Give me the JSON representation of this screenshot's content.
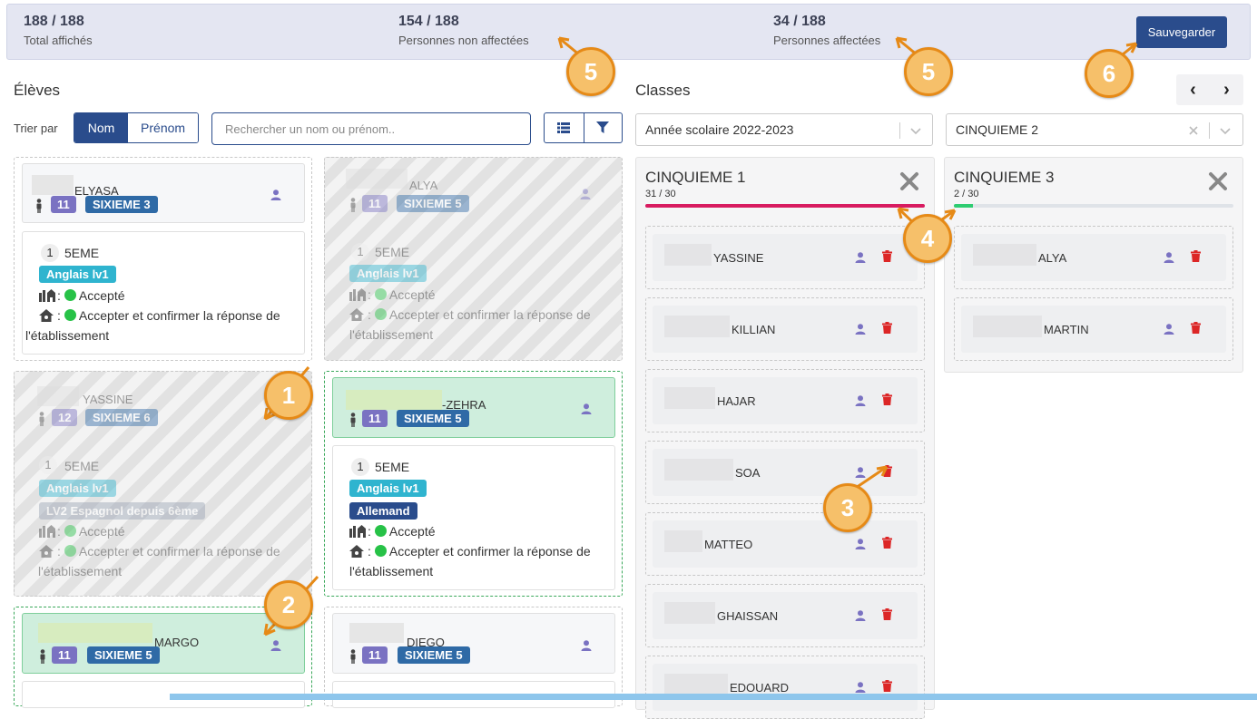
{
  "stats": {
    "total_value": "188 / 188",
    "total_label": "Total affichés",
    "unassigned_value": "154 / 188",
    "unassigned_label": "Personnes non affectées",
    "assigned_value": "34 / 188",
    "assigned_label": "Personnes affectées",
    "save_label": "Sauvegarder"
  },
  "students_panel": {
    "title": "Élèves",
    "sort_label": "Trier par",
    "sort_options": [
      "Nom",
      "Prénom"
    ],
    "search_placeholder": "Rechercher un nom ou prénom.."
  },
  "classes_panel": {
    "title": "Classes",
    "prev": "‹",
    "next": "›",
    "year_select": "Année scolaire 2022-2023",
    "class_select": "CINQUIEME 2"
  },
  "students": [
    {
      "name": "ELYASA",
      "age": "11",
      "class": "SIXIEME 3",
      "rank": "1",
      "level": "5EME",
      "tags": [
        "Anglais lv1"
      ],
      "status1": "Accepté",
      "status2": "Accepter et confirmer la réponse de",
      "status2b": "l'établissement"
    },
    {
      "name": "ALYA",
      "age": "11",
      "class": "SIXIEME 5",
      "rank": "1",
      "level": "5EME",
      "tags": [
        "Anglais lv1"
      ],
      "status1": "Accepté",
      "status2": "Accepter et confirmer la réponse de",
      "status2b": "l'établissement"
    },
    {
      "name": "YASSINE",
      "age": "12",
      "class": "SIXIEME 6",
      "rank": "1",
      "level": "5EME",
      "tags": [
        "Anglais lv1",
        "LV2 Espagnol depuis 6ème"
      ],
      "status1": "Accepté",
      "status2": "Accepter et confirmer la réponse de",
      "status2b": "l'établissement"
    },
    {
      "name": "-ZEHRA",
      "age": "11",
      "class": "SIXIEME 5",
      "rank": "1",
      "level": "5EME",
      "tags": [
        "Anglais lv1",
        "Allemand"
      ],
      "status1": "Accepté",
      "status2": "Accepter et confirmer la réponse de",
      "status2b": "l'établissement"
    },
    {
      "name": "MARGO",
      "age": "11",
      "class": "SIXIEME 5"
    },
    {
      "name": "DIEGO",
      "age": "11",
      "class": "SIXIEME 5"
    }
  ],
  "classes": [
    {
      "name": "CINQUIEME 1",
      "count": "31 / 30",
      "fill": 1.0,
      "color": "#d81b60",
      "students": [
        "YASSINE",
        "KILLIAN",
        "HAJAR",
        "SOA",
        "MATTEO",
        "GHAISSAN",
        "EDOUARD"
      ]
    },
    {
      "name": "CINQUIEME 3",
      "count": "2 / 30",
      "fill": 0.067,
      "color": "#2ecc71",
      "students": [
        "ALYA",
        "MARTIN"
      ]
    }
  ],
  "badges": [
    "1",
    "2",
    "3",
    "4",
    "5",
    "5",
    "6"
  ],
  "colors": {
    "primary": "#2a4c8c",
    "age_badge": "#7a72c2",
    "class_badge": "#2f6aa6",
    "tag_cyan": "#2fb4cf",
    "annotation": "#e68a17"
  }
}
